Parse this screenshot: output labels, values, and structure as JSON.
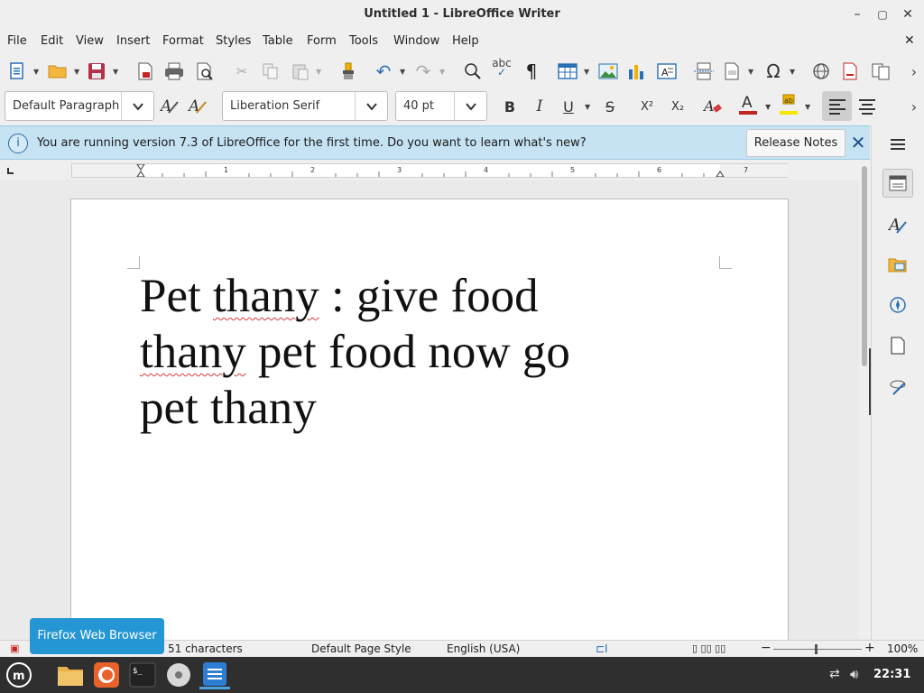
{
  "window": {
    "title": "Untitled 1 - LibreOffice Writer",
    "controls": {
      "minimize": "–",
      "maximize": "▢",
      "close": "✕"
    }
  },
  "menubar": {
    "items": [
      "File",
      "Edit",
      "View",
      "Insert",
      "Format",
      "Styles",
      "Table",
      "Form",
      "Tools",
      "Window",
      "Help"
    ],
    "close_doc": "✕"
  },
  "formatting": {
    "paragraph_style": "Default Paragraph",
    "font_name": "Liberation Serif",
    "font_size": "40 pt",
    "bold": "B",
    "italic": "I",
    "underline": "U",
    "strike": "S",
    "superscript": "X²",
    "subscript": "X₂",
    "font_color": "#c42424",
    "highlight_color": "#f5e600"
  },
  "infobar": {
    "message": "You are running version 7.3 of LibreOffice for the first time. Do you want to learn what's new?",
    "button_label": "Release Notes",
    "icon": "info-icon"
  },
  "ruler": {
    "numbers": [
      "1",
      "2",
      "3",
      "4",
      "5",
      "6",
      "7"
    ]
  },
  "document": {
    "lines": [
      [
        {
          "text": "Pet ",
          "spell_error": false
        },
        {
          "text": "thany",
          "spell_error": true
        },
        {
          "text": " : give food",
          "spell_error": false
        }
      ],
      [
        {
          "text": "thany",
          "spell_error": true
        },
        {
          "text": " pet food now go",
          "spell_error": false
        }
      ],
      [
        {
          "text": "pet thany",
          "spell_error": false
        }
      ]
    ]
  },
  "statusbar": {
    "characters": "51 characters",
    "page_style": "Default Page Style",
    "language": "English (USA)",
    "zoom": "100%"
  },
  "tooltip": {
    "text": "Firefox Web Browser"
  },
  "taskbar": {
    "apps": [
      "mint-menu-icon",
      "files-icon",
      "firefox-icon",
      "terminal-icon",
      "disc-icon",
      "writer-icon"
    ],
    "clock": "22:31"
  }
}
